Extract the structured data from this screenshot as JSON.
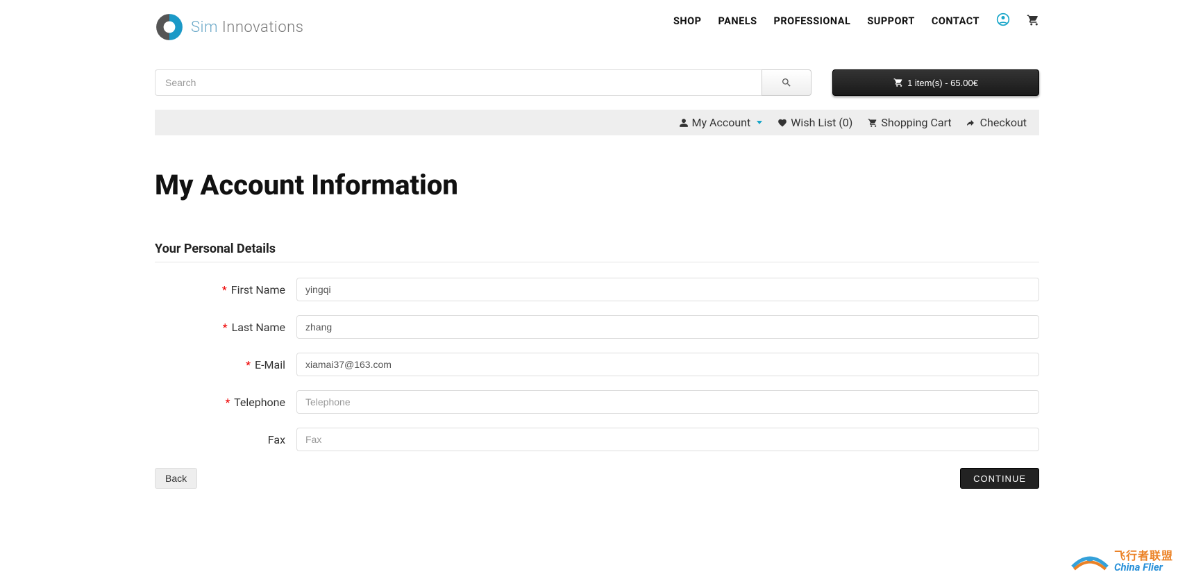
{
  "brand": {
    "name_part1": "Sim",
    "name_part2": " Innovations"
  },
  "topnav": {
    "shop": "SHOP",
    "panels": "PANELS",
    "professional": "PROFESSIONAL",
    "support": "SUPPORT",
    "contact": "CONTACT"
  },
  "search": {
    "placeholder": "Search"
  },
  "cart_summary": "1 item(s) - 65.00€",
  "user_bar": {
    "my_account": "My Account",
    "wish_list": "Wish List (0)",
    "shopping_cart": "Shopping Cart",
    "checkout": "Checkout"
  },
  "page_title": "My Account Information",
  "section_title": "Your Personal Details",
  "form": {
    "first_name": {
      "label": "First Name",
      "value": "yingqi",
      "required": true
    },
    "last_name": {
      "label": "Last Name",
      "value": "zhang",
      "required": true
    },
    "email": {
      "label": "E-Mail",
      "value": "xiamai37@163.com",
      "required": true
    },
    "telephone": {
      "label": "Telephone",
      "value": "",
      "placeholder": "Telephone",
      "required": true
    },
    "fax": {
      "label": "Fax",
      "value": "",
      "placeholder": "Fax",
      "required": false
    }
  },
  "buttons": {
    "back": "Back",
    "continue": "CONTINUE"
  },
  "watermark": {
    "zh": "飞行者联盟",
    "en": "China Flier"
  }
}
